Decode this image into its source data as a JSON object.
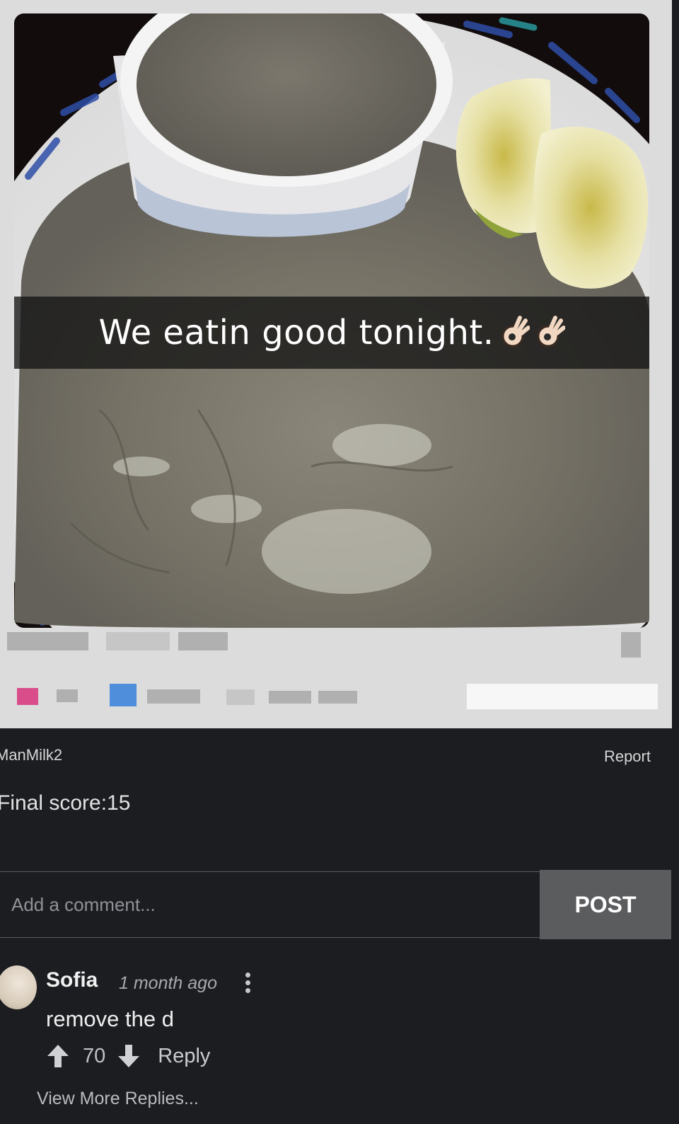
{
  "post": {
    "caption": "We eatin good tonight.",
    "caption_emoji": "ok-hand-icon"
  },
  "meta": {
    "author": "ManMilk2",
    "report_label": "Report",
    "final_score": "Final score:15"
  },
  "comment_form": {
    "placeholder": "Add a comment...",
    "post_label": "POST"
  },
  "comments": [
    {
      "user": "Sofia",
      "time": "1 month ago",
      "text": "remove the d",
      "votes": "70",
      "reply_label": "Reply"
    }
  ],
  "view_more_label": "View More Replies...",
  "colors": {
    "background": "#1b1d21",
    "card": "#dcdcdc",
    "post_button": "#5b5c5e"
  }
}
